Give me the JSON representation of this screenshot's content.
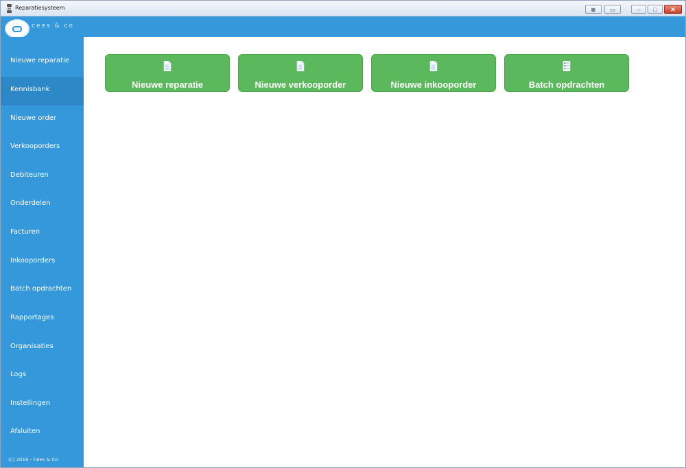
{
  "window": {
    "title": "Reparatiesysteem"
  },
  "header": {
    "logo_text": "cees & co"
  },
  "sidebar": {
    "items": [
      {
        "label": "Nieuwe reparatie",
        "name": "sidebar-item-nieuwe-reparatie",
        "active": false
      },
      {
        "label": "Kennisbank",
        "name": "sidebar-item-kennisbank",
        "active": true
      },
      {
        "label": "Nieuwe order",
        "name": "sidebar-item-nieuwe-order",
        "active": false
      },
      {
        "label": "Verkooporders",
        "name": "sidebar-item-verkooporders",
        "active": false
      },
      {
        "label": "Debiteuren",
        "name": "sidebar-item-debiteuren",
        "active": false
      },
      {
        "label": "Onderdelen",
        "name": "sidebar-item-onderdelen",
        "active": false
      },
      {
        "label": "Facturen",
        "name": "sidebar-item-facturen",
        "active": false
      },
      {
        "label": "Inkooporders",
        "name": "sidebar-item-inkooporders",
        "active": false
      },
      {
        "label": "Batch opdrachten",
        "name": "sidebar-item-batch-opdrachten",
        "active": false
      },
      {
        "label": "Rapportages",
        "name": "sidebar-item-rapportages",
        "active": false
      },
      {
        "label": "Organisaties",
        "name": "sidebar-item-organisaties",
        "active": false
      },
      {
        "label": "Logs",
        "name": "sidebar-item-logs",
        "active": false
      },
      {
        "label": "Instellingen",
        "name": "sidebar-item-instellingen",
        "active": false
      },
      {
        "label": "Afsluiten",
        "name": "sidebar-item-afsluiten",
        "active": false
      }
    ],
    "copyright": "(c) 2016 - Cees & Co"
  },
  "tiles": [
    {
      "label": "Nieuwe reparatie",
      "icon": "document-icon"
    },
    {
      "label": "Nieuwe verkooporder",
      "icon": "document-icon"
    },
    {
      "label": "Nieuwe inkooporder",
      "icon": "document-icon"
    },
    {
      "label": "Batch opdrachten",
      "icon": "checklist-icon"
    }
  ],
  "colors": {
    "brand_blue": "#3498db",
    "active_nav": "#2d88c8",
    "tile_green": "#5cb85c",
    "close_red": "#c8412b"
  }
}
